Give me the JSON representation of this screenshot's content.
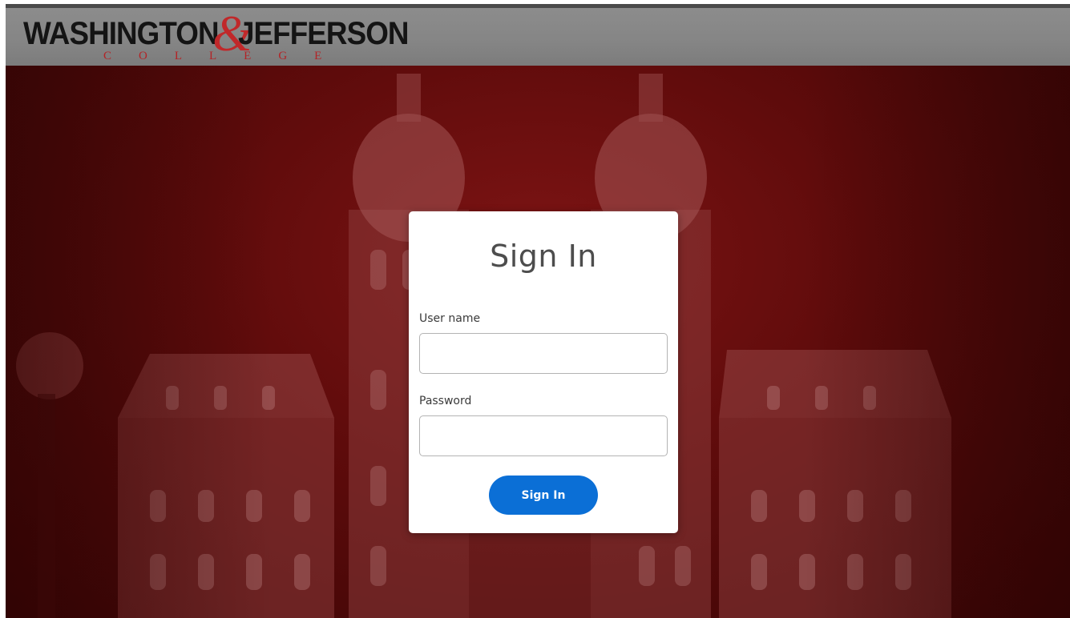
{
  "header": {
    "logo": {
      "word_left": "WASHINGTON",
      "ampersand": "&",
      "word_right": "JEFFERSON",
      "subtitle": "COLLEGE"
    }
  },
  "colors": {
    "header_bg": "#858585",
    "hero_red": "#6e0e0e",
    "logo_accent": "#c0282a",
    "button_blue": "#0b6fd6",
    "card_bg": "#ffffff"
  },
  "login": {
    "title": "Sign In",
    "username_label": "User name",
    "username_value": "",
    "password_label": "Password",
    "password_value": "",
    "submit_label": "Sign In"
  }
}
